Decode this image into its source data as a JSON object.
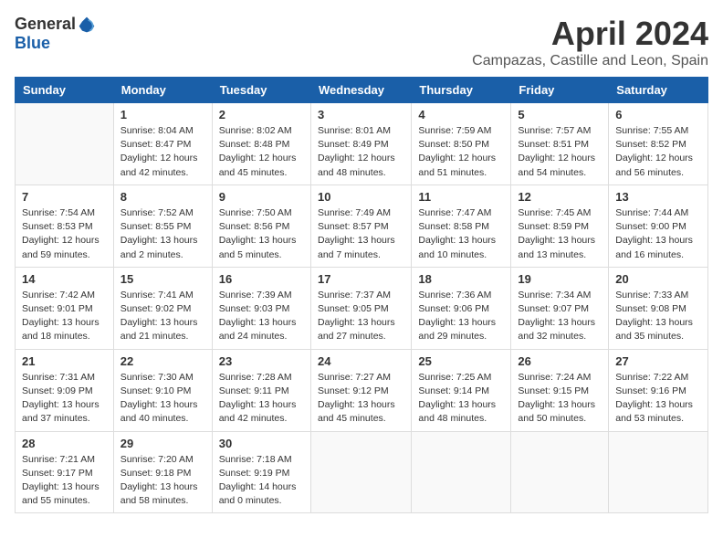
{
  "header": {
    "logo_general": "General",
    "logo_blue": "Blue",
    "month_title": "April 2024",
    "location": "Campazas, Castille and Leon, Spain"
  },
  "weekdays": [
    "Sunday",
    "Monday",
    "Tuesday",
    "Wednesday",
    "Thursday",
    "Friday",
    "Saturday"
  ],
  "weeks": [
    [
      {
        "day": "",
        "info": ""
      },
      {
        "day": "1",
        "info": "Sunrise: 8:04 AM\nSunset: 8:47 PM\nDaylight: 12 hours\nand 42 minutes."
      },
      {
        "day": "2",
        "info": "Sunrise: 8:02 AM\nSunset: 8:48 PM\nDaylight: 12 hours\nand 45 minutes."
      },
      {
        "day": "3",
        "info": "Sunrise: 8:01 AM\nSunset: 8:49 PM\nDaylight: 12 hours\nand 48 minutes."
      },
      {
        "day": "4",
        "info": "Sunrise: 7:59 AM\nSunset: 8:50 PM\nDaylight: 12 hours\nand 51 minutes."
      },
      {
        "day": "5",
        "info": "Sunrise: 7:57 AM\nSunset: 8:51 PM\nDaylight: 12 hours\nand 54 minutes."
      },
      {
        "day": "6",
        "info": "Sunrise: 7:55 AM\nSunset: 8:52 PM\nDaylight: 12 hours\nand 56 minutes."
      }
    ],
    [
      {
        "day": "7",
        "info": "Sunrise: 7:54 AM\nSunset: 8:53 PM\nDaylight: 12 hours\nand 59 minutes."
      },
      {
        "day": "8",
        "info": "Sunrise: 7:52 AM\nSunset: 8:55 PM\nDaylight: 13 hours\nand 2 minutes."
      },
      {
        "day": "9",
        "info": "Sunrise: 7:50 AM\nSunset: 8:56 PM\nDaylight: 13 hours\nand 5 minutes."
      },
      {
        "day": "10",
        "info": "Sunrise: 7:49 AM\nSunset: 8:57 PM\nDaylight: 13 hours\nand 7 minutes."
      },
      {
        "day": "11",
        "info": "Sunrise: 7:47 AM\nSunset: 8:58 PM\nDaylight: 13 hours\nand 10 minutes."
      },
      {
        "day": "12",
        "info": "Sunrise: 7:45 AM\nSunset: 8:59 PM\nDaylight: 13 hours\nand 13 minutes."
      },
      {
        "day": "13",
        "info": "Sunrise: 7:44 AM\nSunset: 9:00 PM\nDaylight: 13 hours\nand 16 minutes."
      }
    ],
    [
      {
        "day": "14",
        "info": "Sunrise: 7:42 AM\nSunset: 9:01 PM\nDaylight: 13 hours\nand 18 minutes."
      },
      {
        "day": "15",
        "info": "Sunrise: 7:41 AM\nSunset: 9:02 PM\nDaylight: 13 hours\nand 21 minutes."
      },
      {
        "day": "16",
        "info": "Sunrise: 7:39 AM\nSunset: 9:03 PM\nDaylight: 13 hours\nand 24 minutes."
      },
      {
        "day": "17",
        "info": "Sunrise: 7:37 AM\nSunset: 9:05 PM\nDaylight: 13 hours\nand 27 minutes."
      },
      {
        "day": "18",
        "info": "Sunrise: 7:36 AM\nSunset: 9:06 PM\nDaylight: 13 hours\nand 29 minutes."
      },
      {
        "day": "19",
        "info": "Sunrise: 7:34 AM\nSunset: 9:07 PM\nDaylight: 13 hours\nand 32 minutes."
      },
      {
        "day": "20",
        "info": "Sunrise: 7:33 AM\nSunset: 9:08 PM\nDaylight: 13 hours\nand 35 minutes."
      }
    ],
    [
      {
        "day": "21",
        "info": "Sunrise: 7:31 AM\nSunset: 9:09 PM\nDaylight: 13 hours\nand 37 minutes."
      },
      {
        "day": "22",
        "info": "Sunrise: 7:30 AM\nSunset: 9:10 PM\nDaylight: 13 hours\nand 40 minutes."
      },
      {
        "day": "23",
        "info": "Sunrise: 7:28 AM\nSunset: 9:11 PM\nDaylight: 13 hours\nand 42 minutes."
      },
      {
        "day": "24",
        "info": "Sunrise: 7:27 AM\nSunset: 9:12 PM\nDaylight: 13 hours\nand 45 minutes."
      },
      {
        "day": "25",
        "info": "Sunrise: 7:25 AM\nSunset: 9:14 PM\nDaylight: 13 hours\nand 48 minutes."
      },
      {
        "day": "26",
        "info": "Sunrise: 7:24 AM\nSunset: 9:15 PM\nDaylight: 13 hours\nand 50 minutes."
      },
      {
        "day": "27",
        "info": "Sunrise: 7:22 AM\nSunset: 9:16 PM\nDaylight: 13 hours\nand 53 minutes."
      }
    ],
    [
      {
        "day": "28",
        "info": "Sunrise: 7:21 AM\nSunset: 9:17 PM\nDaylight: 13 hours\nand 55 minutes."
      },
      {
        "day": "29",
        "info": "Sunrise: 7:20 AM\nSunset: 9:18 PM\nDaylight: 13 hours\nand 58 minutes."
      },
      {
        "day": "30",
        "info": "Sunrise: 7:18 AM\nSunset: 9:19 PM\nDaylight: 14 hours\nand 0 minutes."
      },
      {
        "day": "",
        "info": ""
      },
      {
        "day": "",
        "info": ""
      },
      {
        "day": "",
        "info": ""
      },
      {
        "day": "",
        "info": ""
      }
    ]
  ]
}
